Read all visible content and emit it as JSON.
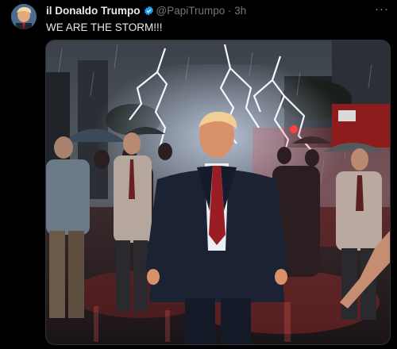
{
  "post": {
    "display_name": "il Donaldo Trumpo",
    "handle": "@PapiTrumpo",
    "separator": "·",
    "time": "3h",
    "text": "WE ARE THE STORM!!!",
    "more_glyph": "···",
    "verified_icon": "verified-badge-icon",
    "accent_color": "#1d9bf0"
  },
  "media": {
    "icon": "image-icon",
    "alt": ""
  }
}
